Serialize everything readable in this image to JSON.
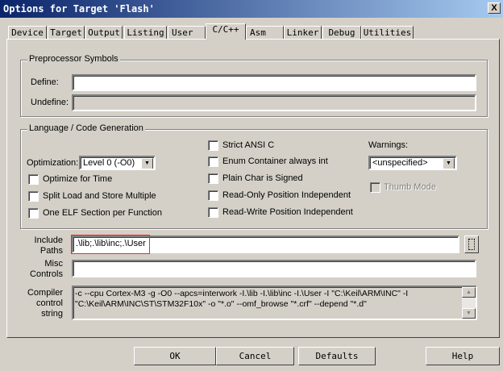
{
  "window": {
    "title": "Options for Target 'Flash'",
    "close": "X"
  },
  "tabs": [
    "Device",
    "Target",
    "Output",
    "Listing",
    "User",
    "C/C++",
    "Asm",
    "Linker",
    "Debug",
    "Utilities"
  ],
  "active_tab": "C/C++",
  "preprocessor": {
    "legend": "Preprocessor Symbols",
    "define_label": "Define:",
    "define_value": "",
    "undefine_label": "Undefine:",
    "undefine_value": ""
  },
  "language": {
    "legend": "Language / Code Generation",
    "optimization_label": "Optimization:",
    "optimization_value": "Level 0 (-O0)",
    "left_checks": [
      {
        "label": "Optimize for Time",
        "checked": false
      },
      {
        "label": "Split Load and Store Multiple",
        "checked": false
      },
      {
        "label": "One ELF Section per Function",
        "checked": false
      }
    ],
    "mid_checks": [
      {
        "label": "Strict ANSI C",
        "checked": false
      },
      {
        "label": "Enum Container always int",
        "checked": false
      },
      {
        "label": "Plain Char is Signed",
        "checked": false
      },
      {
        "label": "Read-Only Position Independent",
        "checked": false
      },
      {
        "label": "Read-Write Position Independent",
        "checked": false
      }
    ],
    "warnings_label": "Warnings:",
    "warnings_value": "<unspecified>",
    "thumb_mode": {
      "label": "Thumb Mode",
      "checked": false,
      "disabled": true
    }
  },
  "include": {
    "label1": "Include",
    "label2": "Paths",
    "value": ".\\lib;.\\lib\\inc;.\\User",
    "browse": "..."
  },
  "misc": {
    "label1": "Misc",
    "label2": "Controls",
    "value": ""
  },
  "compiler": {
    "label1": "Compiler",
    "label2": "control",
    "label3": "string",
    "line1": "-c --cpu Cortex-M3 -g -O0 --apcs=interwork -I.\\lib -I.\\lib\\inc -I.\\User -I \"C:\\Keil\\ARM\\INC\" -I",
    "line2": "\"C:\\Keil\\ARM\\INC\\ST\\STM32F10x\" -o \"*.o\" --omf_browse \"*.crf\" --depend \"*.d\""
  },
  "buttons": {
    "ok": "OK",
    "cancel": "Cancel",
    "defaults": "Defaults",
    "help": "Help"
  },
  "colors": {
    "title_start": "#0a246a",
    "title_end": "#a6caf0",
    "face": "#d4d0c8",
    "highlight": "#e03030"
  }
}
